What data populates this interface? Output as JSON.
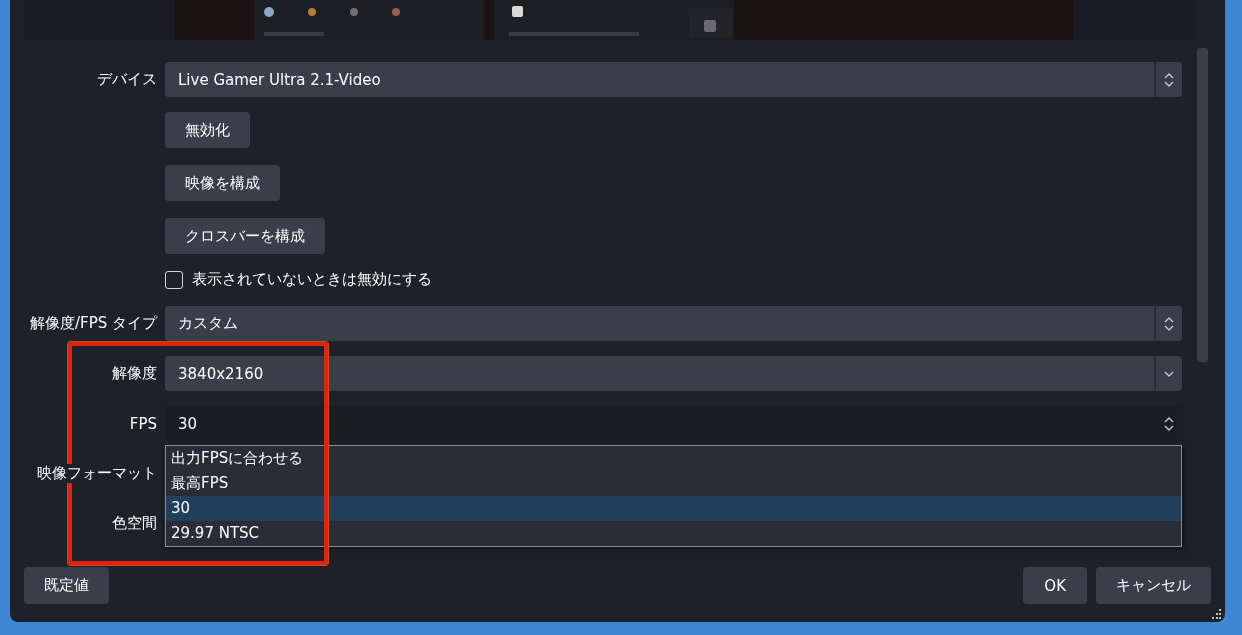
{
  "form": {
    "rows": [
      {
        "kind": "spin-combo",
        "label": "デバイス",
        "value": "Live Gamer Ultra 2.1-Video",
        "open": false
      },
      {
        "kind": "button",
        "text": "無効化"
      },
      {
        "kind": "button",
        "text": "映像を構成"
      },
      {
        "kind": "button",
        "text": "クロスバーを構成"
      },
      {
        "kind": "checkbox",
        "text": "表示されていないときは無効にする",
        "checked": false
      },
      {
        "kind": "spin-combo",
        "label": "解像度/FPS タイプ",
        "value": "カスタム",
        "open": false
      },
      {
        "kind": "combo",
        "label": "解像度",
        "value": "3840x2160",
        "open": false
      },
      {
        "kind": "spin-combo",
        "label": "FPS",
        "value": "30",
        "open": true
      },
      {
        "kind": "label",
        "label": "映像フォーマット"
      },
      {
        "kind": "label",
        "label": "色空間"
      }
    ]
  },
  "fps_dropdown": {
    "options": [
      {
        "text": "出力FPSに合わせる",
        "selected": false
      },
      {
        "text": "最高FPS",
        "selected": false
      },
      {
        "text": "30",
        "selected": true
      },
      {
        "text": "29.97 NTSC",
        "selected": false
      }
    ]
  },
  "annotation": {
    "kind": "highlight-frame"
  },
  "footer": {
    "left_buttons": [
      "既定値"
    ],
    "right_buttons": [
      "OK",
      "キャンセル"
    ]
  }
}
